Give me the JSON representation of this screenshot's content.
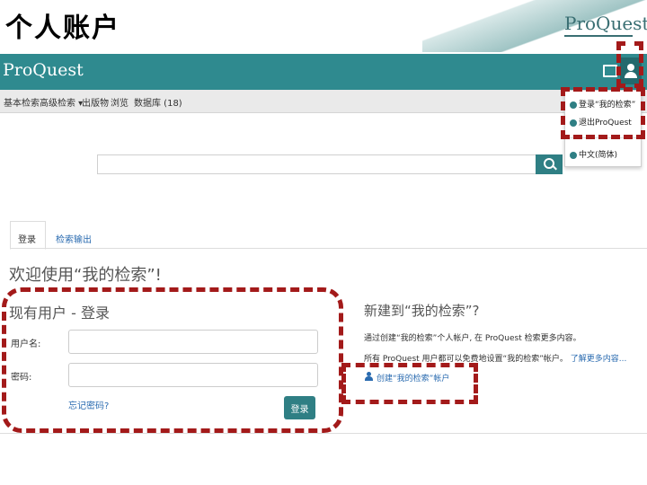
{
  "slide": {
    "title": "个人账户"
  },
  "corner_logo": "ProQuest",
  "header": {
    "logo": "ProQuest"
  },
  "nav": {
    "items": [
      "基本检索",
      "高级检索 ▾",
      "出版物",
      "浏览",
      "数据库 (18)"
    ]
  },
  "user_menu": {
    "items": [
      "登录“我的检索”",
      "退出ProQuest",
      "中文(简体)"
    ]
  },
  "tabs": [
    "登录",
    "检索输出"
  ],
  "welcome": "欢迎使用“我的检索”!",
  "login": {
    "heading": "现有用户 - 登录",
    "username_label": "用户名:",
    "password_label": "密码:",
    "forgot": "忘记密码?",
    "submit": "登录"
  },
  "signup": {
    "heading": "新建到“我的检索”?",
    "line1": "通过创建“我的检索”个人帐户, 在 ProQuest 检索更多内容。",
    "line2": "所有 ProQuest 用户都可以免费地设置“我的检索”帐户。",
    "line2_link": "了解更多内容...",
    "create_link": "创建“我的检索”帐户"
  },
  "colors": {
    "brand": "#2f8a8f",
    "highlight": "#a31a1a",
    "link": "#2a6bb0"
  },
  "icons": [
    "folder-icon",
    "user-icon",
    "search-icon",
    "login-icon",
    "logout-icon",
    "globe-icon",
    "person-icon"
  ]
}
